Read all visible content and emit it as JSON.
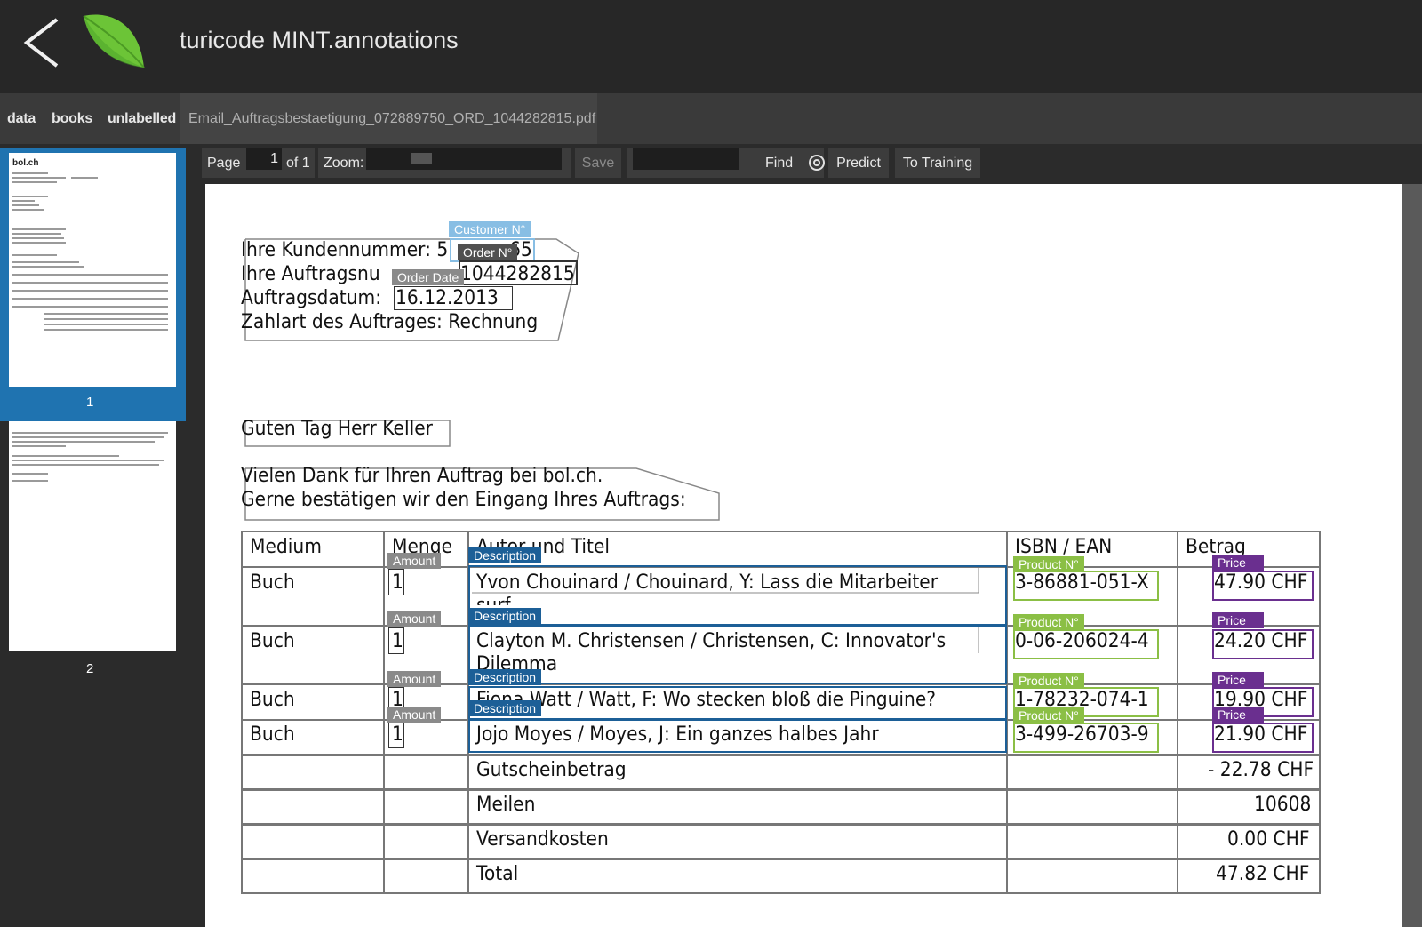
{
  "header": {
    "title": "turicode MINT.annotations"
  },
  "breadcrumb": {
    "items": [
      "data",
      "books",
      "unlabelled"
    ],
    "file": "Email_Auftragsbestaetigung_072889750_ORD_1044282815.pdf"
  },
  "thumbnails": [
    {
      "page": "1",
      "logo": "bol.ch"
    },
    {
      "page": "2"
    }
  ],
  "toolbar": {
    "page_label": "Page",
    "page_value": "1",
    "page_total": "of 1",
    "zoom_label": "Zoom:",
    "save_label": "Save",
    "find_label": "Find",
    "predict_label": "Predict",
    "training_label": "To Training"
  },
  "document": {
    "info_lines": [
      "Ihre Kundennummer: 5",
      "65",
      "Ihre Auftragsnu",
      "1044282815",
      "Auftragsdatum: ",
      "16.12.2013",
      "Zahlart des Auftrages: Rechnung"
    ],
    "greeting": "Guten Tag Herr Keller",
    "thanks": [
      "Vielen Dank für Ihren Auftrag bei bol.ch.",
      "Gerne bestätigen wir den Eingang Ihres Auftrags:"
    ],
    "table_headers": [
      "Medium",
      "Menge",
      "Autor und Titel",
      "ISBN / EAN",
      "Betrag"
    ],
    "rows": [
      {
        "medium": "Buch",
        "menge": "1",
        "title": "Yvon Chouinard / Chouinard, Y: Lass die Mitarbeiter",
        "title2": "surf",
        "isbn": "3-86881-051-X",
        "betrag": "47.90 CHF"
      },
      {
        "medium": "Buch",
        "menge": "1",
        "title": "Clayton M. Christensen / Christensen, C: Innovator's",
        "title2": "Dilemma",
        "isbn": "0-06-206024-4",
        "betrag": "24.20 CHF"
      },
      {
        "medium": "Buch",
        "menge": "1",
        "title": "Fiona Watt / Watt, F: Wo stecken bloß die Pinguine?",
        "title2": "",
        "isbn": "1-78232-074-1",
        "betrag": "19.90 CHF"
      },
      {
        "medium": "Buch",
        "menge": "1",
        "title": "Jojo Moyes / Moyes, J: Ein ganzes halbes Jahr",
        "title2": "",
        "isbn": "3-499-26703-9",
        "betrag": "21.90 CHF"
      }
    ],
    "summary": [
      {
        "label": "Gutscheinbetrag",
        "value": "- 22.78 CHF"
      },
      {
        "label": "Meilen",
        "value": "10608"
      },
      {
        "label": "Versandkosten",
        "value": "0.00 CHF"
      },
      {
        "label": "Total",
        "value": "47.82 CHF"
      }
    ]
  },
  "annotations": {
    "customer_no": "Customer N°",
    "order_no": "Order N°",
    "order_date": "Order Date",
    "amount": "Amount",
    "description": "Description",
    "product_no": "Product N°",
    "price": "Price"
  },
  "colors": {
    "description": "#1c5f97",
    "product": "#8bbf45",
    "price": "#6a2f8f",
    "amount": "#8a8a8a",
    "customer": "#88bee4",
    "thumb_active": "#1f73b0"
  }
}
